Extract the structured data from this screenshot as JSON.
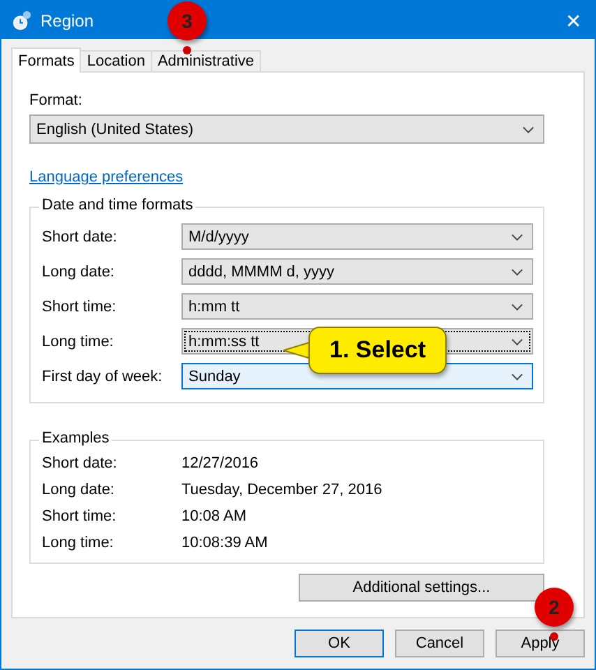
{
  "window": {
    "title": "Region",
    "close": "✕"
  },
  "tabs": [
    {
      "label": "Formats",
      "selected": true
    },
    {
      "label": "Location",
      "selected": false
    },
    {
      "label": "Administrative",
      "selected": false
    }
  ],
  "format": {
    "label": "Format:",
    "value": "English (United States)"
  },
  "link": "Language preferences",
  "formats_group": {
    "title": "Date and time formats",
    "rows": [
      {
        "label": "Short date:",
        "value": "M/d/yyyy",
        "focused": false,
        "hovered": false
      },
      {
        "label": "Long date:",
        "value": "dddd, MMMM d, yyyy",
        "focused": false,
        "hovered": false
      },
      {
        "label": "Short time:",
        "value": "h:mm tt",
        "focused": false,
        "hovered": false
      },
      {
        "label": "Long time:",
        "value": "h:mm:ss tt",
        "focused": true,
        "hovered": false
      },
      {
        "label": "First day of week:",
        "value": "Sunday",
        "focused": false,
        "hovered": true
      }
    ]
  },
  "examples": {
    "title": "Examples",
    "rows": [
      {
        "label": "Short date:",
        "value": "12/27/2016"
      },
      {
        "label": "Long date:",
        "value": "Tuesday, December 27, 2016"
      },
      {
        "label": "Short time:",
        "value": "10:08 AM"
      },
      {
        "label": "Long time:",
        "value": "10:08:39 AM"
      }
    ]
  },
  "additional_button": "Additional settings...",
  "buttons": [
    {
      "label": "OK",
      "default": true
    },
    {
      "label": "Cancel",
      "default": false
    },
    {
      "label": "Apply",
      "default": false
    }
  ],
  "annotations": [
    {
      "kind": "badge",
      "text": "3"
    },
    {
      "kind": "callout",
      "text": "1. Select"
    },
    {
      "kind": "badge",
      "text": "2"
    }
  ]
}
